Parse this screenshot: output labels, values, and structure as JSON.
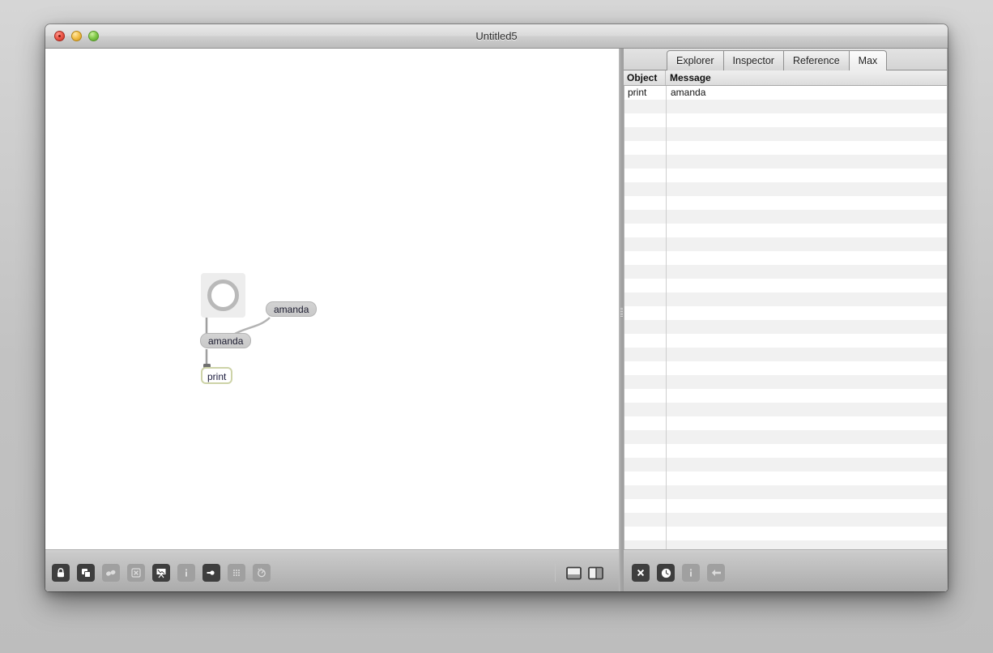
{
  "window": {
    "title": "Untitled5",
    "controls": [
      {
        "name": "close",
        "color": "#f05b4d"
      },
      {
        "name": "minimize",
        "color": "#f5c24e"
      },
      {
        "name": "zoom",
        "color": "#86cc4e"
      }
    ]
  },
  "patcher": {
    "objects": [
      {
        "name": "bang-object",
        "type": "bang",
        "label": ""
      },
      {
        "name": "message-box-left",
        "type": "message",
        "label": "amanda"
      },
      {
        "name": "message-box-right",
        "type": "message",
        "label": "amanda"
      },
      {
        "name": "print-object",
        "type": "object",
        "label": "print"
      }
    ],
    "toolbar": {
      "left_items": [
        {
          "icon": "lock-icon",
          "label": "Lock",
          "state": "on"
        },
        {
          "icon": "shapes-icon",
          "label": "Presentation Mode",
          "state": "on"
        },
        {
          "icon": "binoculars-icon",
          "label": "View",
          "state": "off"
        },
        {
          "icon": "close-box-icon",
          "label": "Remove",
          "state": "off"
        },
        {
          "icon": "easel-icon",
          "label": "Presentation",
          "state": "on"
        },
        {
          "icon": "info-icon",
          "label": "Inspector",
          "state": "off"
        },
        {
          "icon": "arrow-in-icon",
          "label": "Open Inspector",
          "state": "on"
        },
        {
          "icon": "grid-icon",
          "label": "Grid",
          "state": "off"
        },
        {
          "icon": "gauge-icon",
          "label": "Debug",
          "state": "off"
        }
      ],
      "right_items": [
        {
          "icon": "panel-bottom-icon",
          "label": "Bottom Panel",
          "state": "plain"
        },
        {
          "icon": "panel-side-icon",
          "label": "Side Panel",
          "state": "plain"
        }
      ]
    }
  },
  "console": {
    "tabs": [
      {
        "label": "Explorer",
        "active": false
      },
      {
        "label": "Inspector",
        "active": false
      },
      {
        "label": "Reference",
        "active": false
      },
      {
        "label": "Max",
        "active": true
      }
    ],
    "columns": [
      "Object",
      "Message"
    ],
    "rows": [
      {
        "object": "print",
        "message": "amanda"
      }
    ],
    "empty_row_count": 34,
    "toolbar": {
      "items": [
        {
          "icon": "clear-icon",
          "label": "Clear",
          "state": "on"
        },
        {
          "icon": "clock-icon",
          "label": "Timestamp",
          "state": "on"
        },
        {
          "icon": "info-icon",
          "label": "Info",
          "state": "off"
        },
        {
          "icon": "back-arrow-icon",
          "label": "Back",
          "state": "off"
        }
      ]
    }
  }
}
